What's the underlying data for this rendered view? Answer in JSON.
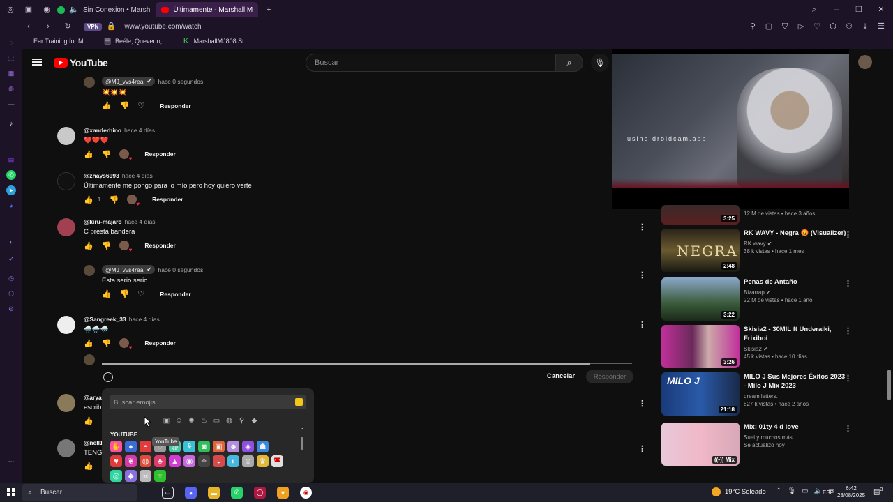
{
  "browser": {
    "tabs": [
      {
        "label": "Sin Conexion • Marsh",
        "active": false,
        "color": "#1db954"
      },
      {
        "label": "Últimamente - Marshall M",
        "active": true,
        "color": "#ff0000"
      }
    ],
    "url": "www.youtube.com/watch",
    "vpn_label": "VPN",
    "bookmarks": [
      "Ear Training for M...",
      "Beéle, Quevedo,...",
      "MarshallMJ808 St..."
    ]
  },
  "youtube": {
    "logo_text": "YouTube",
    "search_placeholder": "Buscar"
  },
  "comments": [
    {
      "author": "@MJ_vvs4real",
      "verified": true,
      "time": "hace 0 segundos",
      "text": "💥💥💥",
      "reply_label": "Responder",
      "is_reply": true
    },
    {
      "author": "@xanderhino",
      "time": "hace 4 días",
      "text": "❤️❤️❤️",
      "reply_label": "Responder"
    },
    {
      "author": "@zhays6993",
      "time": "hace 4 días",
      "text": "Últimamente me pongo para lo mío pero hoy quiero verte",
      "likes": "1",
      "reply_label": "Responder"
    },
    {
      "author": "@kiru-majaro",
      "time": "hace 4 días",
      "text": "C presta bandera",
      "reply_label": "Responder"
    },
    {
      "author": "@MJ_vvs4real",
      "verified": true,
      "time": "hace 0 segundos",
      "text": "Esta serio serio",
      "reply_label": "Responder",
      "is_reply": true
    },
    {
      "author": "@Sangreek_33",
      "time": "hace 4 días",
      "text": "🌧️🌧️🌧️",
      "reply_label": "Responder"
    },
    {
      "author": "@aryal",
      "time": "",
      "text": "escrib",
      "reply_label": ""
    },
    {
      "author": "@nell1",
      "time": "",
      "text": "TENG",
      "reply_label": ""
    }
  ],
  "reply_box": {
    "cancel_label": "Cancelar",
    "submit_label": "Responder"
  },
  "emoji_picker": {
    "search_placeholder": "Buscar emojis",
    "section_label": "YOUTUBE",
    "tooltip": "YouTube"
  },
  "recommendations": [
    {
      "title": "",
      "channel": "",
      "meta": "12 M de vistas • hace 3 años",
      "duration": "3:25"
    },
    {
      "title": "RK WAVY - Negra 😡 (Visualizer)",
      "channel": "RK wavy",
      "verified": true,
      "meta": "38 k vistas • hace 1 mes",
      "duration": "2:48"
    },
    {
      "title": "Penas de Antaño",
      "channel": "Bizarrap",
      "verified": true,
      "meta": "22 M de vistas • hace 1 año",
      "duration": "3:22"
    },
    {
      "title": "Skisia2 - 30MIL ft Underaiki, Frixiboi",
      "channel": "Skisia2",
      "verified": true,
      "meta": "45 k vistas • hace 10 días",
      "duration": "3:26"
    },
    {
      "title": "MILO J Sus Mejores Éxitos 2023 - Milo J Mix 2023",
      "channel": "dream letters.",
      "meta": "827 k vistas • hace 2 años",
      "duration": "21:18"
    },
    {
      "title": "Mix: 01ty 4 d love",
      "channel": "Suei y muchos más",
      "meta": "Se actualizó hoy",
      "duration": "Mix"
    }
  ],
  "player": {
    "watermark": "using droidcam.app"
  },
  "taskbar": {
    "search_label": "Buscar",
    "weather": "19°C Soleado",
    "language": "ESP",
    "time": "6:42",
    "date": "28/08/2025",
    "notifications": "3"
  }
}
